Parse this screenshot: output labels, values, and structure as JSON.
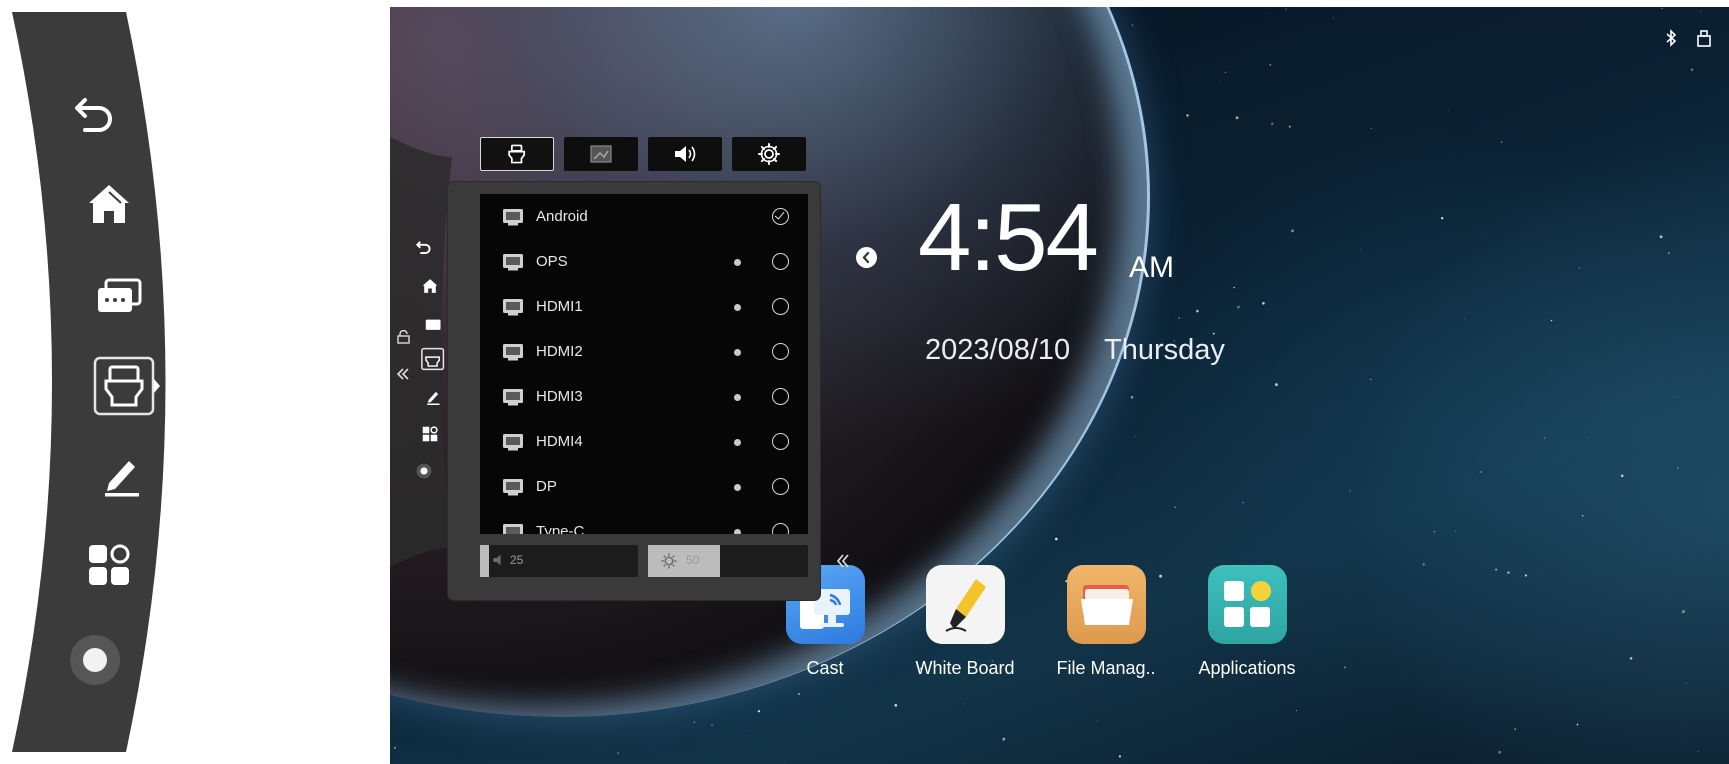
{
  "big_toolbar": {
    "items": [
      {
        "name": "back-icon"
      },
      {
        "name": "home-icon"
      },
      {
        "name": "multitask-icon"
      },
      {
        "name": "input-source-icon",
        "active": true
      },
      {
        "name": "pen-icon"
      },
      {
        "name": "apps-icon"
      },
      {
        "name": "record-icon"
      }
    ]
  },
  "status_bar": {
    "icons": [
      "bluetooth-icon",
      "usb-icon"
    ]
  },
  "clock": {
    "time": "4:54",
    "ampm": "AM",
    "date": "2023/08/10",
    "weekday": "Thursday"
  },
  "source_panel": {
    "tabs": [
      {
        "name": "input-tab",
        "icon": "input-source-icon",
        "active": true
      },
      {
        "name": "display-tab",
        "icon": "picture-icon"
      },
      {
        "name": "audio-tab",
        "icon": "speaker-icon"
      },
      {
        "name": "settings-tab",
        "icon": "gear-icon"
      }
    ],
    "sources": [
      {
        "label": "Android",
        "selected": true,
        "signal_dot": false
      },
      {
        "label": "OPS",
        "selected": false,
        "signal_dot": true
      },
      {
        "label": "HDMI1",
        "selected": false,
        "signal_dot": true
      },
      {
        "label": "HDMI2",
        "selected": false,
        "signal_dot": true
      },
      {
        "label": "HDMI3",
        "selected": false,
        "signal_dot": true
      },
      {
        "label": "HDMI4",
        "selected": false,
        "signal_dot": true
      },
      {
        "label": "DP",
        "selected": false,
        "signal_dot": true
      },
      {
        "label": "Type-C",
        "selected": false,
        "signal_dot": true
      }
    ],
    "volume": {
      "value": "25",
      "level": 0.25
    },
    "brightness": {
      "value": "50",
      "level": 0.5
    }
  },
  "apps": [
    {
      "label": "Cast",
      "icon": "cast-icon"
    },
    {
      "label": "White Board",
      "icon": "whiteboard-pen-icon"
    },
    {
      "label": "File Manag..",
      "icon": "folder-icon"
    },
    {
      "label": "Applications",
      "icon": "applications-grid-icon"
    }
  ],
  "colors": {
    "toolbar_bg": "#3b3b3b",
    "panel_bg": "#3a3a3a",
    "list_bg": "#060606",
    "cast_tile": "#3d8ee8",
    "whiteboard_tile": "#f4f4f4",
    "files_tile": "#e9a85c",
    "apps_tile": "#35b3b0"
  }
}
